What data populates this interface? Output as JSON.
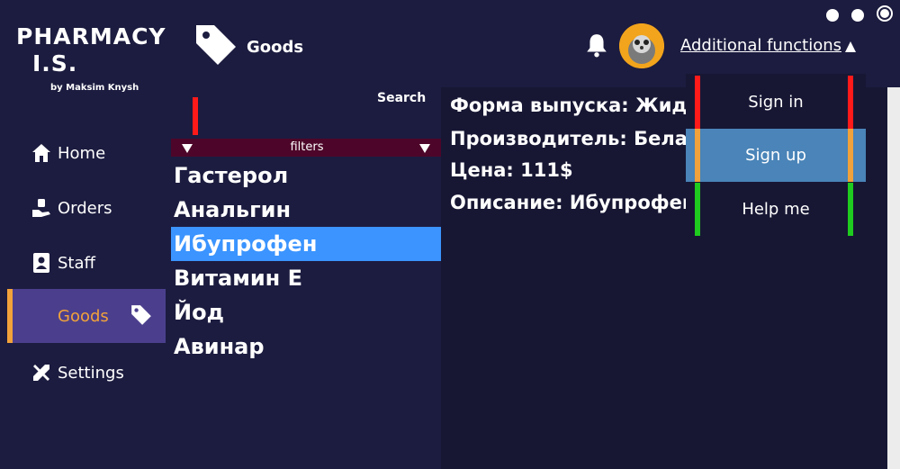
{
  "app": {
    "title": "PHARMACY",
    "title_line2": "I.S.",
    "author": "by Maksim Knysh"
  },
  "sidebar": {
    "items": [
      {
        "label": "Home",
        "icon": "home-icon"
      },
      {
        "label": "Orders",
        "icon": "orders-icon"
      },
      {
        "label": "Staff",
        "icon": "staff-icon"
      },
      {
        "label": "Goods",
        "icon": "tag-icon",
        "active": true
      },
      {
        "label": "Settings",
        "icon": "settings-icon"
      }
    ]
  },
  "header": {
    "title": "Goods",
    "additional_functions": "Additional functions"
  },
  "search": {
    "label": "Search",
    "value": ""
  },
  "filters": {
    "label": "filters"
  },
  "goods": {
    "items": [
      "Гастерол",
      "Анальгин",
      "Ибупрофен",
      "Витамин Е",
      "Йод",
      "Авинар"
    ],
    "selected_index": 2
  },
  "details": {
    "form": "Форма выпуска: Жидк",
    "manufacturer": "Производитель: Белар",
    "price": "Цена: 111$",
    "description": "Описание: Ибупрофен"
  },
  "dropdown": {
    "items": [
      {
        "label": "Sign in",
        "bar_color": "#ff1a1a"
      },
      {
        "label": "Sign up",
        "bar_color": "#f2a23a",
        "highlighted": true
      },
      {
        "label": "Help me",
        "bar_color": "#1ecb1e"
      }
    ]
  },
  "colors": {
    "background": "#1c1c40",
    "active_nav": "#4b3f8d",
    "accent_orange": "#f2a23a",
    "selected_row": "#3b94ff",
    "filters_bar": "#4d0629",
    "highlight_item": "#4a84b8"
  }
}
